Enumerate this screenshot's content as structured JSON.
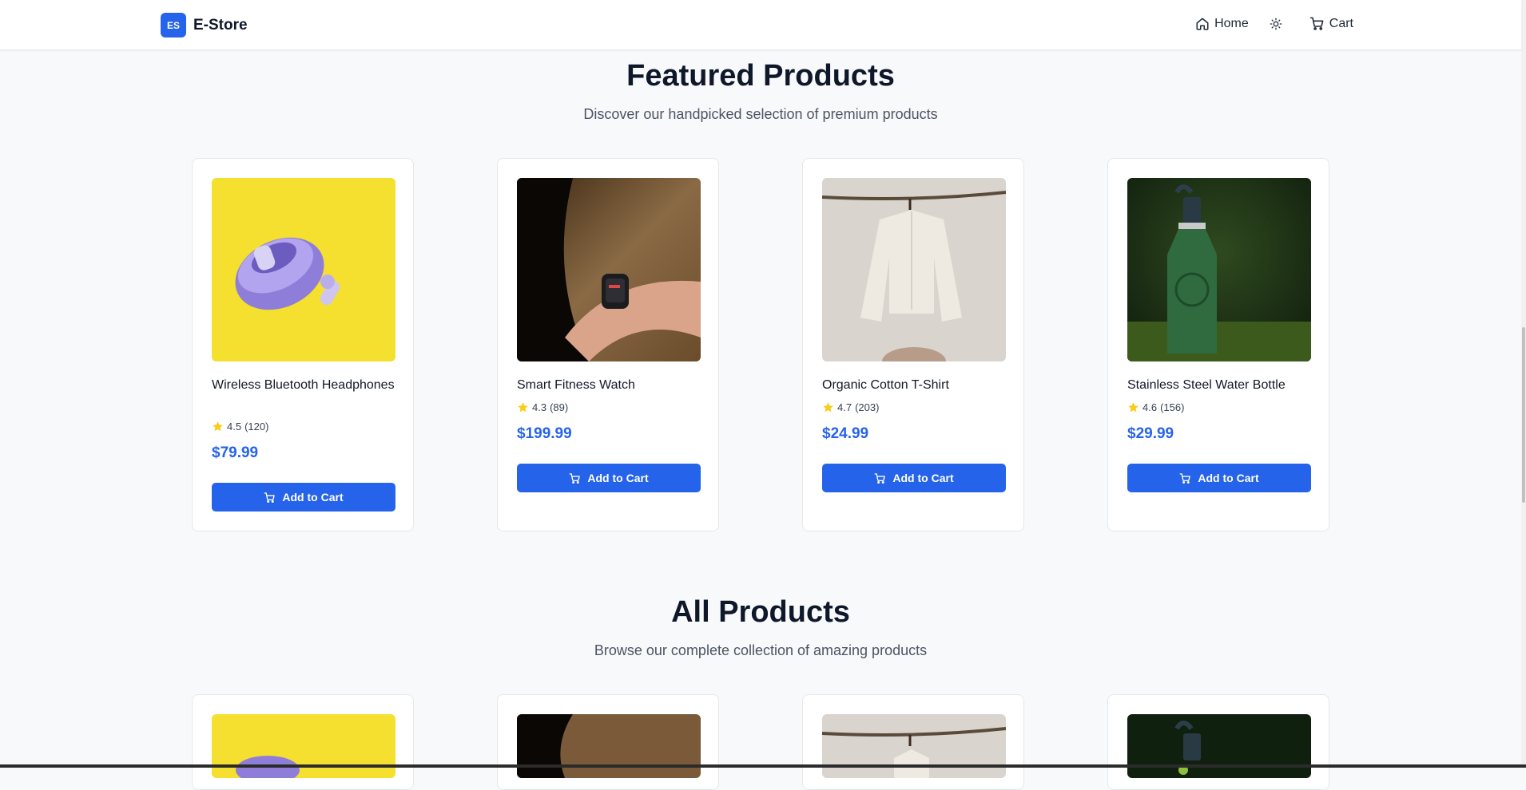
{
  "header": {
    "logo_badge": "ES",
    "logo_text": "E-Store",
    "nav": {
      "home_label": "Home",
      "cart_label": "Cart"
    }
  },
  "featured": {
    "title": "Featured Products",
    "subtitle": "Discover our handpicked selection of premium products",
    "products": [
      {
        "name": "Wireless Bluetooth Headphones",
        "rating": "4.5",
        "reviews": "(120)",
        "price": "$79.99",
        "button": "Add to Cart"
      },
      {
        "name": "Smart Fitness Watch",
        "rating": "4.3",
        "reviews": "(89)",
        "price": "$199.99",
        "button": "Add to Cart"
      },
      {
        "name": "Organic Cotton T-Shirt",
        "rating": "4.7",
        "reviews": "(203)",
        "price": "$24.99",
        "button": "Add to Cart"
      },
      {
        "name": "Stainless Steel Water Bottle",
        "rating": "4.6",
        "reviews": "(156)",
        "price": "$29.99",
        "button": "Add to Cart"
      }
    ]
  },
  "all_products": {
    "title": "All Products",
    "subtitle": "Browse our complete collection of amazing products"
  },
  "colors": {
    "accent": "#2563eb",
    "star": "#facc15",
    "background": "#f8f9fb"
  }
}
